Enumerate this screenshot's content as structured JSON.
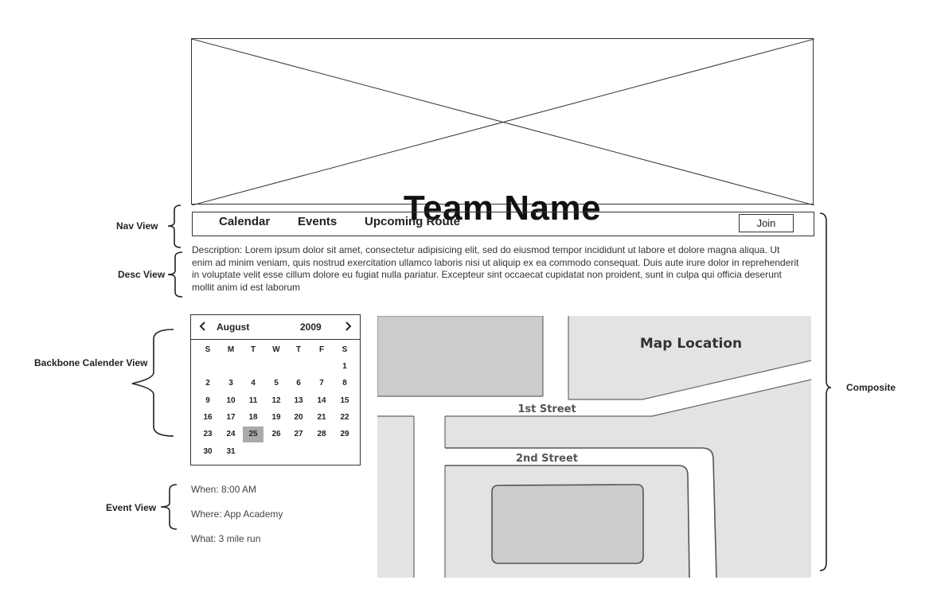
{
  "hero": {
    "title": "Team Name"
  },
  "nav": {
    "items": [
      {
        "label": "Calendar"
      },
      {
        "label": "Events"
      },
      {
        "label": "Upcoming Route"
      }
    ],
    "join_label": "Join"
  },
  "description": "Description:  Lorem ipsum dolor sit amet, consectetur adipisicing elit, sed do eiusmod tempor incididunt ut labore et dolore magna aliqua. Ut enim ad minim veniam, quis nostrud exercitation ullamco laboris nisi ut aliquip ex ea commodo consequat. Duis aute irure dolor in reprehenderit in voluptate velit esse cillum dolore eu fugiat nulla pariatur. Excepteur sint occaecat cupidatat non proident, sunt in culpa qui officia deserunt mollit anim id est laborum",
  "calendar": {
    "prev_icon": "chevron-left-icon",
    "next_icon": "chevron-right-icon",
    "month": "August",
    "year": "2009",
    "weekdays": [
      "S",
      "M",
      "T",
      "W",
      "T",
      "F",
      "S"
    ],
    "weeks": [
      [
        "",
        "",
        "",
        "",
        "",
        "",
        "1"
      ],
      [
        "2",
        "3",
        "4",
        "5",
        "6",
        "7",
        "8"
      ],
      [
        "9",
        "10",
        "11",
        "12",
        "13",
        "14",
        "15"
      ],
      [
        "16",
        "17",
        "18",
        "19",
        "20",
        "21",
        "22"
      ],
      [
        "23",
        "24",
        "25",
        "26",
        "27",
        "28",
        "29"
      ],
      [
        "30",
        "31",
        "",
        "",
        "",
        "",
        ""
      ]
    ],
    "selected_day": "25"
  },
  "event": {
    "when": "When: 8:00 AM",
    "where": "Where: App Academy",
    "what": "What: 3 mile run"
  },
  "map": {
    "title": "Map Location",
    "street_1": "1st Street",
    "street_2": "2nd Street"
  },
  "annotations": {
    "nav_view": "Nav View",
    "desc_view": "Desc View",
    "calendar_view": "Backbone Calender View",
    "event_view": "Event View",
    "composite": "Composite"
  }
}
